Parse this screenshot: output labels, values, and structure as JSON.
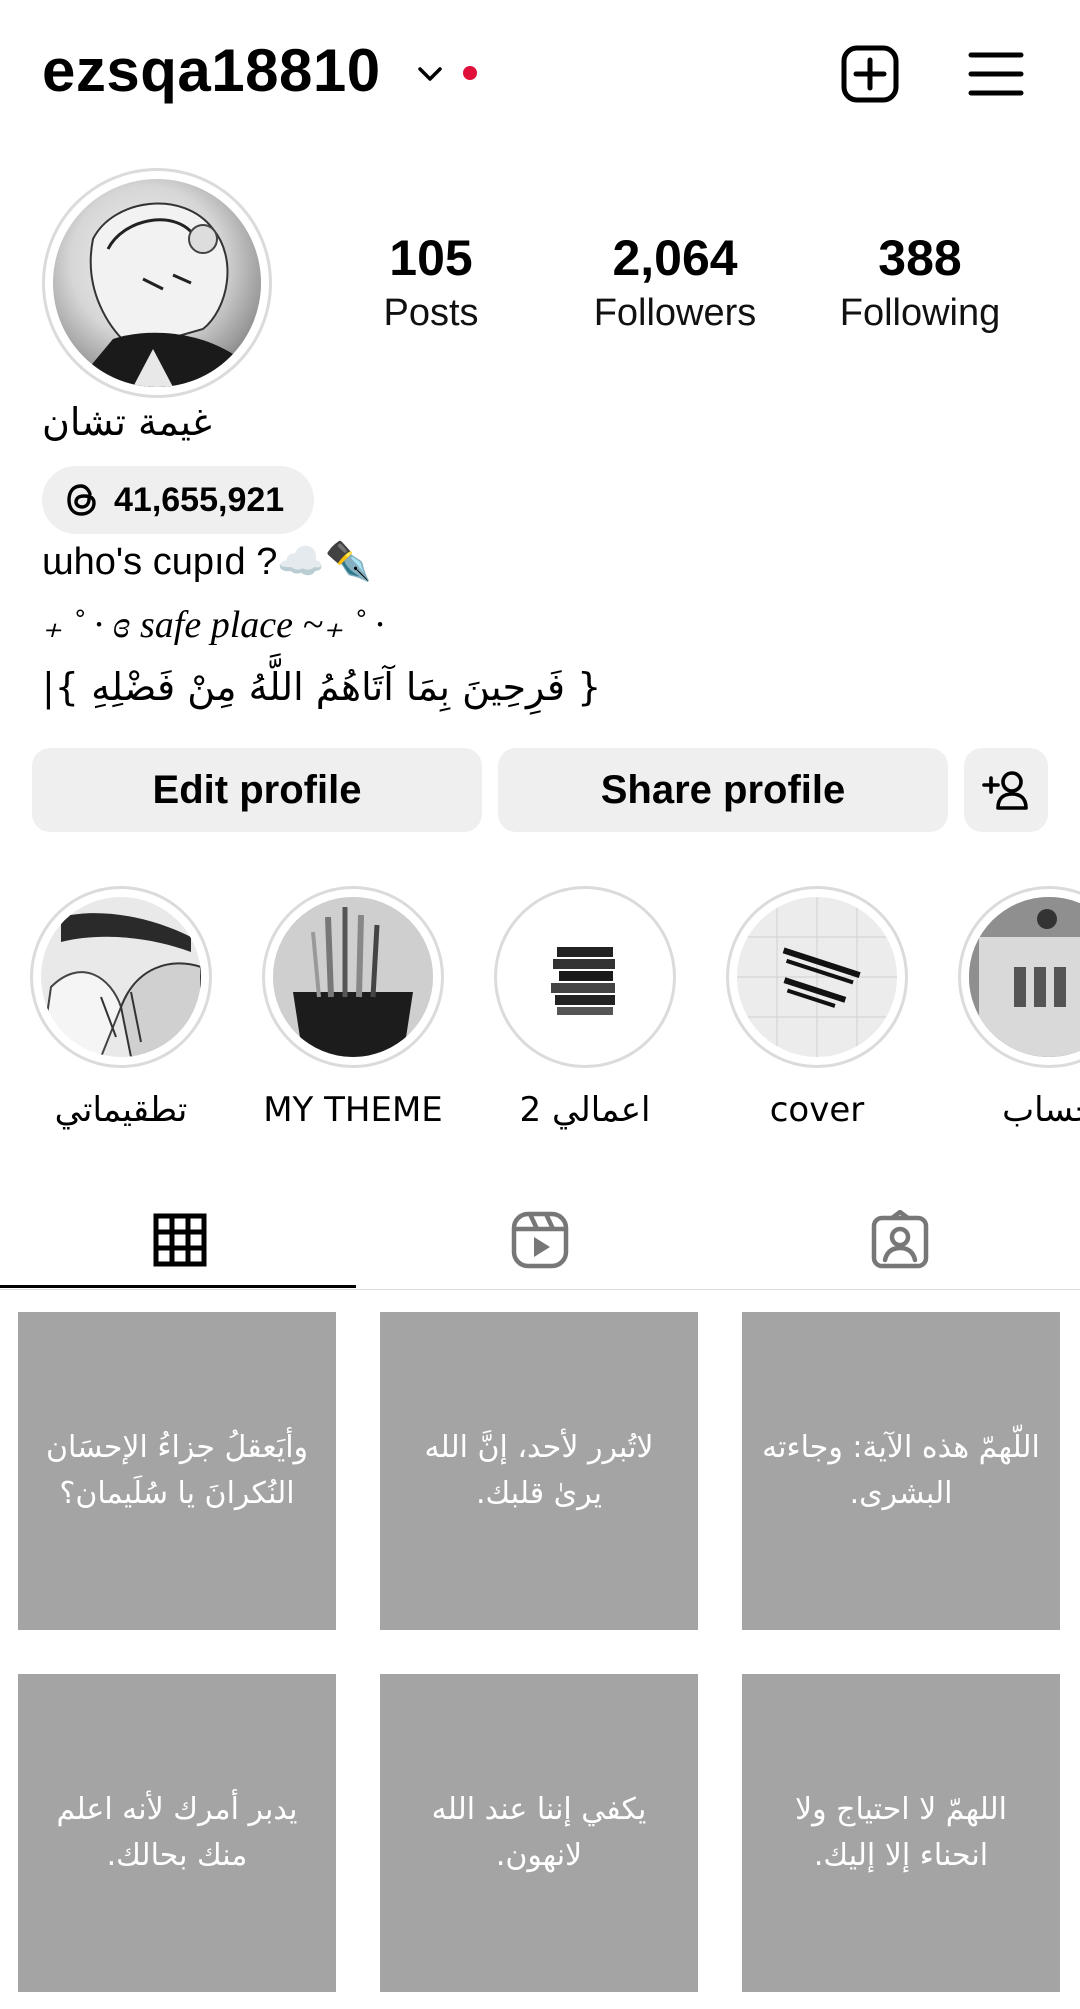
{
  "header": {
    "username": "ezsqa18810",
    "has_notification_dot": true,
    "dot_color": "#e0103a",
    "create_icon": "add-square-icon",
    "menu_icon": "hamburger-menu-icon"
  },
  "profile": {
    "full_name": "غيمة تشان",
    "stats": {
      "posts": {
        "value": "105",
        "label": "Posts"
      },
      "followers": {
        "value": "2,064",
        "label": "Followers"
      },
      "following": {
        "value": "388",
        "label": "Following"
      }
    },
    "threads_count": "41,655,921",
    "bio_lines": [
      "ɯho's cupıd ?☁️✒️",
      "₊ ˚ · ɞ safe place ~₊ ˚ ·",
      "|{ فَرِحِينَ بِمَا آتَاهُمُ اللَّهُ مِنْ فَضْلِهِ }"
    ]
  },
  "actions": {
    "edit_label": "Edit profile",
    "share_label": "Share profile",
    "add_person_icon": "add-person-icon"
  },
  "highlights": [
    {
      "label": "تطقيماتي"
    },
    {
      "label": "MY THEME"
    },
    {
      "label": "اعمالي 2"
    },
    {
      "label": "cover"
    },
    {
      "label": "حساب"
    }
  ],
  "tabs": [
    {
      "icon": "grid-icon",
      "active": true
    },
    {
      "icon": "reels-icon",
      "active": false
    },
    {
      "icon": "tagged-icon",
      "active": false
    }
  ],
  "posts": [
    {
      "text": "وأيَعقلُ جزاءُ الإحسَان النُكرانَ يا سُلَيمان؟"
    },
    {
      "text": "لاتُبرر لأحد، إنَّ الله يرىٰ قلبك."
    },
    {
      "text": "اللّهمّ هذه الآية: وجاءته البشرى."
    },
    {
      "text": "يدبر أمرك لأنه اعلم منك بحالك."
    },
    {
      "text": "يكفي إننا عند الله لانهون."
    },
    {
      "text": "اللهمّ لا احتياج ولا انحناء إلا إليك."
    }
  ]
}
